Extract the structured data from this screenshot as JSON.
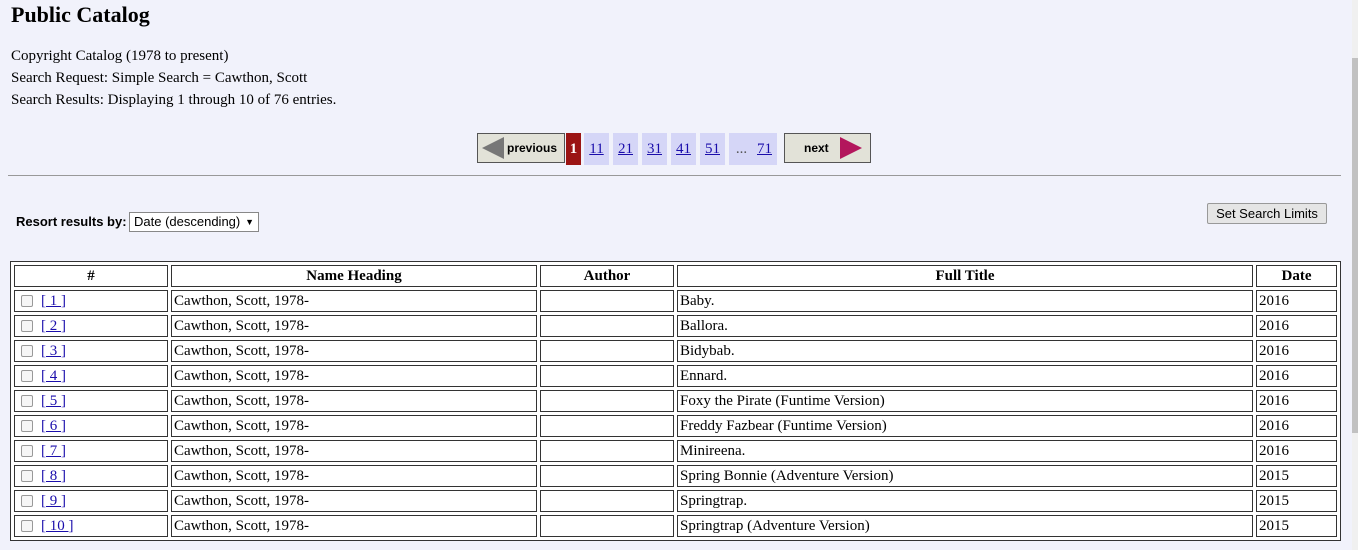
{
  "title": "Public Catalog",
  "info": {
    "catalog": "Copyright Catalog (1978 to present)",
    "request": "Search Request: Simple Search = Cawthon, Scott",
    "results": "Search Results: Displaying 1 through 10 of 76 entries."
  },
  "pager": {
    "previous": "previous",
    "next": "next",
    "pages": [
      "1",
      "11",
      "21",
      "31",
      "41",
      "51",
      "...",
      "71"
    ],
    "current": "1"
  },
  "resort": {
    "label": "Resort results by:",
    "value": "Date (descending)"
  },
  "set_limits": "Set Search Limits",
  "table": {
    "headers": [
      "#",
      "Name Heading",
      "Author",
      "Full Title",
      "Date"
    ],
    "rows": [
      {
        "num": "[ 1 ]",
        "name": "Cawthon, Scott, 1978-",
        "author": "",
        "title": "Baby.",
        "date": "2016"
      },
      {
        "num": "[ 2 ]",
        "name": "Cawthon, Scott, 1978-",
        "author": "",
        "title": "Ballora.",
        "date": "2016"
      },
      {
        "num": "[ 3 ]",
        "name": "Cawthon, Scott, 1978-",
        "author": "",
        "title": "Bidybab.",
        "date": "2016"
      },
      {
        "num": "[ 4 ]",
        "name": "Cawthon, Scott, 1978-",
        "author": "",
        "title": "Ennard.",
        "date": "2016"
      },
      {
        "num": "[ 5 ]",
        "name": "Cawthon, Scott, 1978-",
        "author": "",
        "title": "Foxy the Pirate (Funtime Version)",
        "date": "2016"
      },
      {
        "num": "[ 6 ]",
        "name": "Cawthon, Scott, 1978-",
        "author": "",
        "title": "Freddy Fazbear (Funtime Version)",
        "date": "2016"
      },
      {
        "num": "[ 7 ]",
        "name": "Cawthon, Scott, 1978-",
        "author": "",
        "title": "Minireena.",
        "date": "2016"
      },
      {
        "num": "[ 8 ]",
        "name": "Cawthon, Scott, 1978-",
        "author": "",
        "title": "Spring Bonnie (Adventure Version)",
        "date": "2015"
      },
      {
        "num": "[ 9 ]",
        "name": "Cawthon, Scott, 1978-",
        "author": "",
        "title": "Springtrap.",
        "date": "2015"
      },
      {
        "num": "[ 10 ]",
        "name": "Cawthon, Scott, 1978-",
        "author": "",
        "title": "Springtrap (Adventure Version)",
        "date": "2015"
      }
    ]
  }
}
